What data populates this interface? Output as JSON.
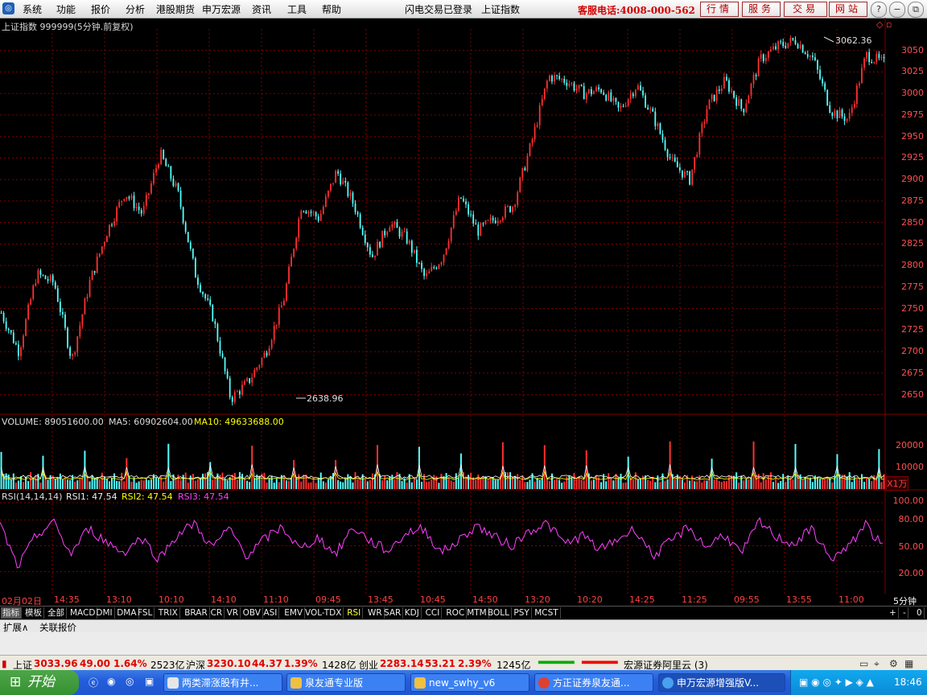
{
  "menu": {
    "items": [
      "系统",
      "功能",
      "报价",
      "分析",
      "港股期货",
      "申万宏源",
      "资讯",
      "工具",
      "帮助"
    ],
    "center_items": [
      "闪电交易已登录",
      "上证指数"
    ],
    "hotline": "客服电话:4008-000-562",
    "right_buttons": [
      "行情",
      "服务",
      "交易",
      "网站"
    ],
    "window_controls": [
      "?",
      "−",
      "⧉",
      "✕"
    ]
  },
  "chart": {
    "title": "上证指数 999999(5分钟.前复权)",
    "high_label": "3062.36",
    "low_label": "2638.96",
    "price_ticks": [
      "3050",
      "3025",
      "3000",
      "2975",
      "2950",
      "2925",
      "2900",
      "2875",
      "2850",
      "2825",
      "2800",
      "2775",
      "2750",
      "2725",
      "2700",
      "2675",
      "2650"
    ],
    "volume": {
      "label": "VOLUME: 89051600.00",
      "ma5": "MA5: 60902604.00",
      "ma10": "MA10: 49633688.00",
      "ticks": [
        "20000",
        "10000"
      ],
      "unit": "X1万"
    },
    "rsi": {
      "label": "RSI(14,14,14)",
      "rsi1": "RSI1: 47.54",
      "rsi2": "RSI2: 47.54",
      "rsi3": "RSI3: 47.54",
      "ticks": [
        "100.00",
        "80.00",
        "50.00",
        "20.00"
      ]
    },
    "time_labels": [
      "02月02日",
      "14:35",
      "13:10",
      "10:10",
      "14:10",
      "11:10",
      "09:45",
      "13:45",
      "10:45",
      "14:50",
      "13:20",
      "10:20",
      "14:25",
      "11:25",
      "09:55",
      "13:55",
      "11:00"
    ],
    "period": "5分钟"
  },
  "chart_data": {
    "type": "line",
    "title": "上证指数 999999(5分钟.前复权)",
    "x": [
      "02月02日",
      "14:35",
      "13:10",
      "10:10",
      "14:10",
      "11:10",
      "09:45",
      "13:45",
      "10:45",
      "14:50",
      "13:20",
      "10:20",
      "14:25",
      "11:25",
      "09:55",
      "13:55",
      "11:00"
    ],
    "series": [
      {
        "name": "上证指数",
        "values": [
          2745,
          2700,
          2790,
          2780,
          2690,
          2780,
          2840,
          2885,
          2860,
          2930,
          2885,
          2790,
          2740,
          2645,
          2665,
          2700,
          2760,
          2870,
          2855,
          2910,
          2870,
          2810,
          2850,
          2830,
          2785,
          2810,
          2880,
          2840,
          2855,
          2870,
          2940,
          3020,
          3015,
          3000,
          3005,
          2980,
          3010,
          2970,
          2920,
          2900,
          2985,
          3015,
          2980,
          3040,
          3055,
          3062,
          3040,
          2980,
          2970,
          3045,
          3035
        ]
      },
      {
        "name": "RSI1",
        "values": [
          75,
          25,
          60,
          78,
          40,
          70,
          55,
          42,
          60,
          35,
          62,
          76,
          48,
          70,
          38,
          58,
          72,
          45,
          60,
          40,
          72,
          55,
          44,
          65,
          70,
          42,
          56,
          74,
          60,
          50,
          68,
          76,
          52,
          62,
          45,
          58,
          70,
          38,
          55,
          72,
          48,
          64,
          40,
          78,
          60,
          52,
          70,
          35,
          46,
          76,
          48
        ]
      }
    ],
    "ylim": [
      2630,
      3075
    ],
    "rsi_ylim": [
      0,
      100
    ],
    "volume_ylim": [
      0,
      25000
    ],
    "grid": true
  },
  "tabs": [
    "指标",
    "模板",
    "全部",
    "MACD",
    "DMI",
    "DMA",
    "FSL",
    "TRIX",
    "BRAR",
    "CR",
    "VR",
    "OBV",
    "ASI",
    "EMV",
    "VOL-TDX",
    "RSI",
    "WR",
    "SAR",
    "KDJ",
    "CCI",
    "ROC",
    "MTM",
    "BOLL",
    "PSY",
    "MCST"
  ],
  "tab_controls": [
    "+",
    "-",
    "0"
  ],
  "extra_tabs": [
    "扩展∧",
    "关联报价"
  ],
  "status": {
    "sh": {
      "name": "上证",
      "price": "3033.96",
      "chg": "49.00",
      "pct": "1.64%",
      "amt": "2523亿"
    },
    "hs": {
      "name": "沪深",
      "price": "3230.10",
      "chg": "44.37",
      "pct": "1.39%",
      "amt": "1428亿"
    },
    "cy": {
      "name": "创业",
      "price": "2283.14",
      "chg": "53.21",
      "pct": "2.39%",
      "amt": "1245亿"
    },
    "server": "宏源证券阿里云 (3)"
  },
  "taskbar": {
    "start": "开始",
    "items": [
      "两类滞涨股有井...",
      "泉友通专业版",
      "new_swhy_v6",
      "方正证券泉友通...",
      "申万宏源增强版V..."
    ],
    "clock": "18:46"
  },
  "colors": {
    "up": "#ff3030",
    "down": "#54ffff",
    "grid": "#800000",
    "rsi": "#ff40ff",
    "ma5": "#ffffff",
    "ma10": "#ffff00"
  }
}
